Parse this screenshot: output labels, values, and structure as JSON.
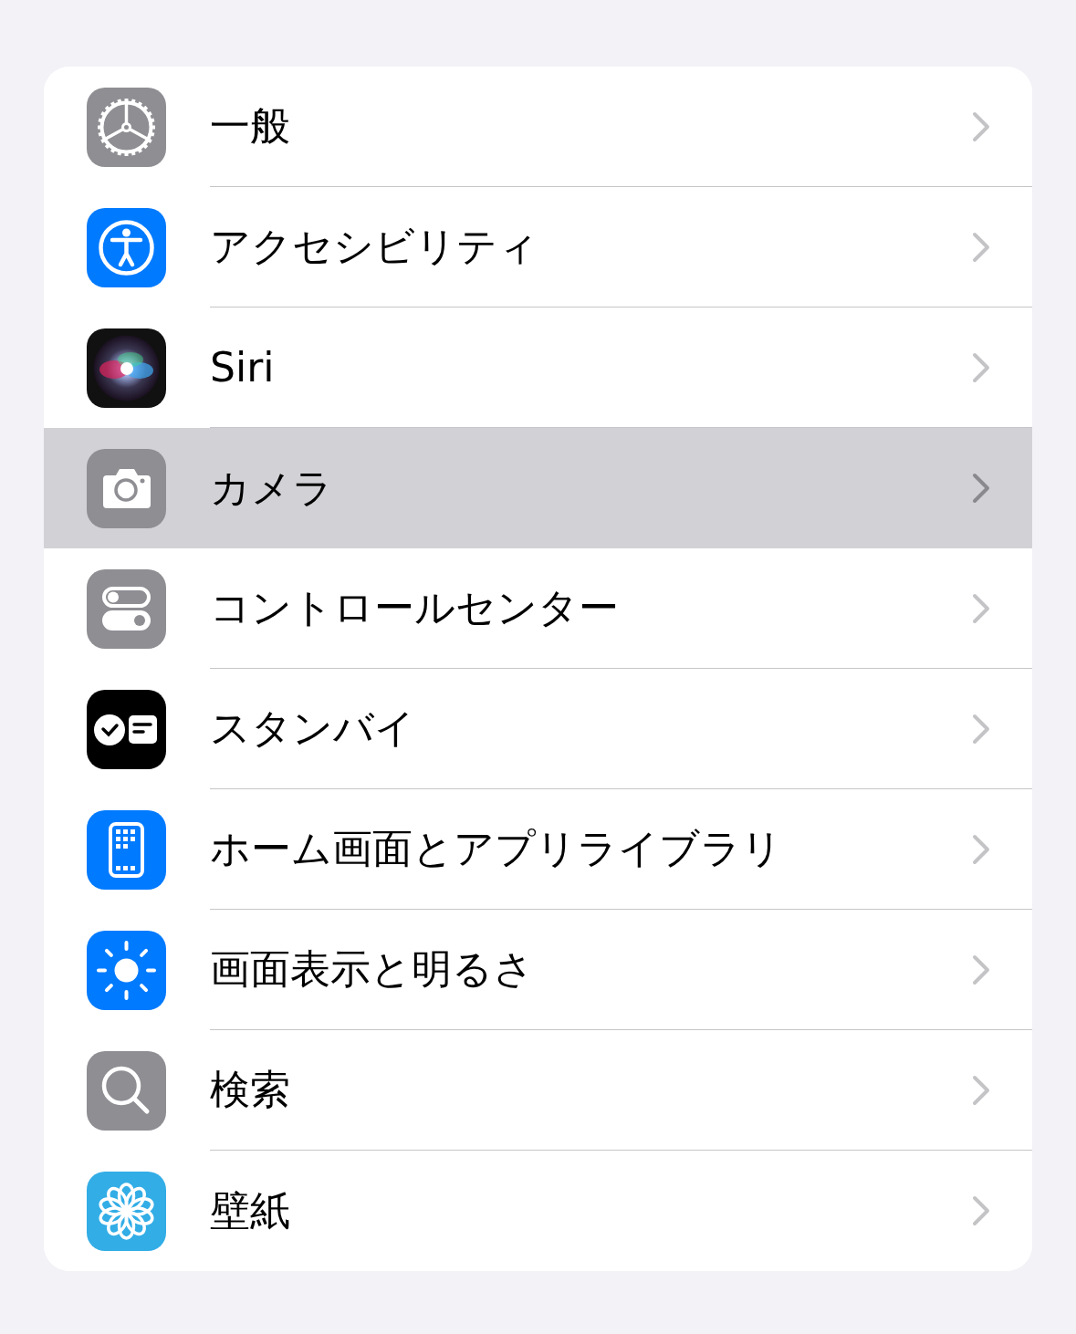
{
  "settings": [
    {
      "label": "一般",
      "kind": "general",
      "selected": false
    },
    {
      "label": "アクセシビリティ",
      "kind": "accessibility",
      "selected": false
    },
    {
      "label": "Siri",
      "kind": "siri",
      "selected": false
    },
    {
      "label": "カメラ",
      "kind": "camera",
      "selected": true
    },
    {
      "label": "コントロールセンター",
      "kind": "control",
      "selected": false
    },
    {
      "label": "スタンバイ",
      "kind": "standby",
      "selected": false
    },
    {
      "label": "ホーム画面とアプリライブラリ",
      "kind": "home",
      "selected": false
    },
    {
      "label": "画面表示と明るさ",
      "kind": "display",
      "selected": false
    },
    {
      "label": "検索",
      "kind": "search",
      "selected": false
    },
    {
      "label": "壁紙",
      "kind": "wallpaper",
      "selected": false
    }
  ]
}
